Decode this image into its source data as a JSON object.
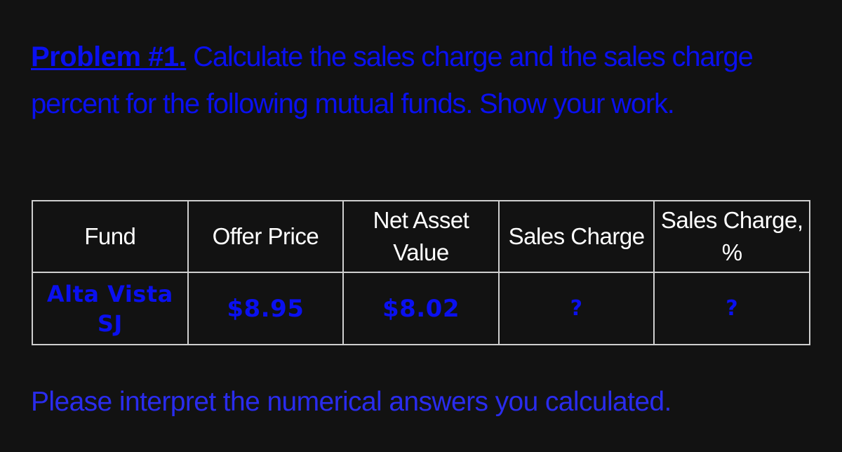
{
  "problem": {
    "label": "Problem #1.",
    "text": " Calculate the sales charge and the sales charge percent for the following mutual funds. Show your work."
  },
  "table": {
    "columns": [
      "Fund",
      "Offer Price",
      "Net Asset Value",
      "Sales Charge",
      "Sales Charge, %"
    ],
    "rows": [
      {
        "fund": "Alta Vista SJ",
        "offer_price": "$8.95",
        "net_asset_value": "$8.02",
        "sales_charge": "?",
        "sales_charge_percent": "?"
      }
    ]
  },
  "footer": {
    "prompt": "Please interpret the numerical answers you calculated."
  },
  "colors": {
    "text_blue": "#0a10f0",
    "header_white": "#ffffff",
    "background": "#121212",
    "border": "#cfcfcf"
  }
}
